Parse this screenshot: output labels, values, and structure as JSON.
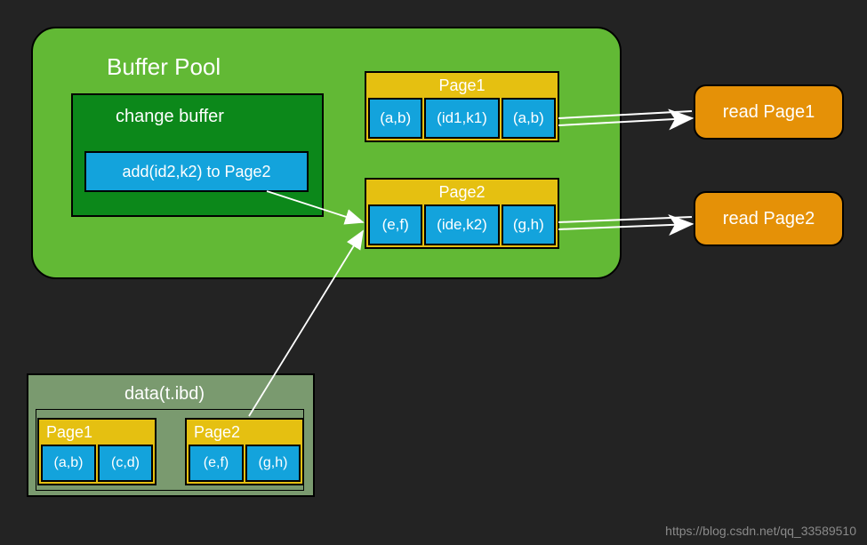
{
  "buffer_pool": {
    "title": "Buffer Pool",
    "change_buffer": {
      "title": "change buffer",
      "entry": "add(id2,k2) to Page2"
    },
    "page1": {
      "title": "Page1",
      "cells": [
        "(a,b)",
        "(id1,k1)",
        "(a,b)"
      ]
    },
    "page2": {
      "title": "Page2",
      "cells": [
        "(e,f)",
        "(ide,k2)",
        "(g,h)"
      ]
    }
  },
  "actions": {
    "read1": "read Page1",
    "read2": "read Page2"
  },
  "ibd": {
    "title": "data(t.ibd)",
    "page1": {
      "title": "Page1",
      "cells": [
        "(a,b)",
        "(c,d)"
      ]
    },
    "page2": {
      "title": "Page2",
      "cells": [
        "(e,f)",
        "(g,h)"
      ]
    }
  },
  "watermark": "https://blog.csdn.net/qq_33589510"
}
